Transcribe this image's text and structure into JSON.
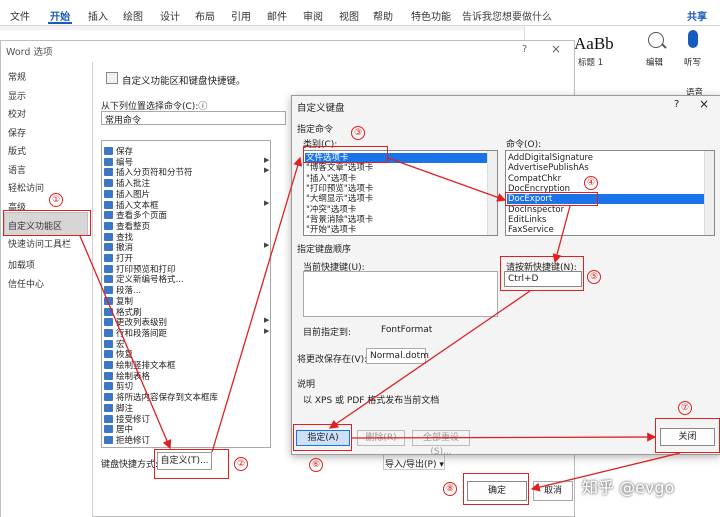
{
  "ribbon": {
    "tabs": [
      "文件",
      "开始",
      "插入",
      "绘图",
      "设计",
      "布局",
      "引用",
      "邮件",
      "审阅",
      "视图",
      "帮助",
      "特色功能"
    ],
    "tell_me": "告诉我您想要做什么",
    "share": "共享",
    "style_preview": "AaBb",
    "style_name": "标题 1",
    "edit": "编辑",
    "listen": "听写",
    "voice": "语音",
    "accent": "#185abd"
  },
  "word_options": {
    "title": "Word 选项",
    "help": "?",
    "close": "×",
    "nav": [
      "常规",
      "显示",
      "校对",
      "保存",
      "版式",
      "语言",
      "轻松访问",
      "高级",
      "自定义功能区",
      "快速访问工具栏",
      "加载项",
      "信任中心"
    ],
    "heading": "自定义功能区和键盘快捷键。",
    "choose_label": "从下列位置选择命令(C):ⓘ",
    "choose_value": "常用命令",
    "commands": [
      {
        "label": "保存",
        "sub": false
      },
      {
        "label": "编号",
        "sub": true
      },
      {
        "label": "插入分页符和分节符",
        "sub": true
      },
      {
        "label": "插入批注",
        "sub": false
      },
      {
        "label": "插入图片",
        "sub": false
      },
      {
        "label": "插入文本框",
        "sub": true
      },
      {
        "label": "查看多个页面",
        "sub": false
      },
      {
        "label": "查看整页",
        "sub": false
      },
      {
        "label": "查找",
        "sub": false
      },
      {
        "label": "撤消",
        "sub": true
      },
      {
        "label": "打开",
        "sub": false
      },
      {
        "label": "打印预览和打印",
        "sub": false
      },
      {
        "label": "定义新编号格式...",
        "sub": false
      },
      {
        "label": "段落...",
        "sub": false
      },
      {
        "label": "复制",
        "sub": false
      },
      {
        "label": "格式刷",
        "sub": false
      },
      {
        "label": "更改列表级别",
        "sub": true
      },
      {
        "label": "行和段落间距",
        "sub": true
      },
      {
        "label": "宏",
        "sub": false
      },
      {
        "label": "恢复",
        "sub": false
      },
      {
        "label": "绘制竖排文本框",
        "sub": false
      },
      {
        "label": "绘制表格",
        "sub": false
      },
      {
        "label": "剪切",
        "sub": false
      },
      {
        "label": "将所选内容保存到文本框库",
        "sub": false
      },
      {
        "label": "脚注",
        "sub": false
      },
      {
        "label": "接受修订",
        "sub": false
      },
      {
        "label": "居中",
        "sub": false
      },
      {
        "label": "拒绝修订",
        "sub": false
      }
    ],
    "shortcut_label": "键盘快捷方式:",
    "customize_button": "自定义(T)...",
    "import_export": "导入/导出(P) ▾",
    "ok": "确定",
    "cancel": "取消"
  },
  "customize_keyboard": {
    "title": "自定义键盘",
    "help": "?",
    "close": "×",
    "group_command": "指定命令",
    "categories_label": "类别(C):",
    "categories": [
      "文件选项卡",
      "\"博客文章\"选项卡",
      "\"插入\"选项卡",
      "\"打印预览\"选项卡",
      "\"大纲显示\"选项卡",
      "\"冲突\"选项卡",
      "\"背景消除\"选项卡",
      "\"开始\"选项卡"
    ],
    "commands_label": "命令(O):",
    "commands": [
      "AddDigitalSignature",
      "AdvertisePublishAs",
      "CompatChkr",
      "DocEncryption",
      "DocExport",
      "DocInspector",
      "EditLinks",
      "FaxService"
    ],
    "group_keys": "指定键盘顺序",
    "current_keys_label": "当前快捷键(U):",
    "new_key_label": "请按新快捷键(N):",
    "new_key_value": "Ctrl+D",
    "assigned_label": "目前指定到:",
    "assigned_value": "FontFormat",
    "save_in_label": "将更改保存在(V):",
    "save_in_value": "Normal.dotm",
    "description_label": "说明",
    "description": "以 XPS 或 PDF 格式发布当前文档",
    "assign": "指定(A)",
    "remove": "删除(R)",
    "reset_all": "全部重设(S)...",
    "close_button": "关闭"
  },
  "annotations": {
    "color": "#e02020",
    "numbers": [
      "①",
      "②",
      "③",
      "④",
      "⑤",
      "⑥",
      "⑦",
      "⑧"
    ]
  },
  "watermark": "知乎 @evgo"
}
